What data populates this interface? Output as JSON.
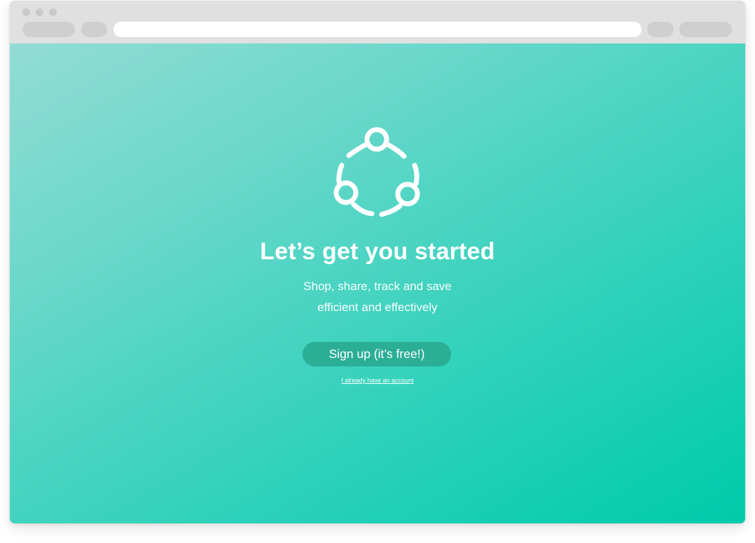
{
  "browser": {
    "address_bar_value": ""
  },
  "hero": {
    "logo_icon": "share-circle-icon",
    "title": "Let’s get you started",
    "subtitle_line1": "Shop, share, track and save",
    "subtitle_line2": "efficient and effectively",
    "signup_label": "Sign up (it’s free!)",
    "login_link_label": "I already have an account"
  },
  "colors": {
    "gradient_start": "#92dcd5",
    "gradient_end": "#00cbaa",
    "button_bg": "#2bae96",
    "text": "#ffffff",
    "chrome_bg": "#e0e0e0"
  }
}
